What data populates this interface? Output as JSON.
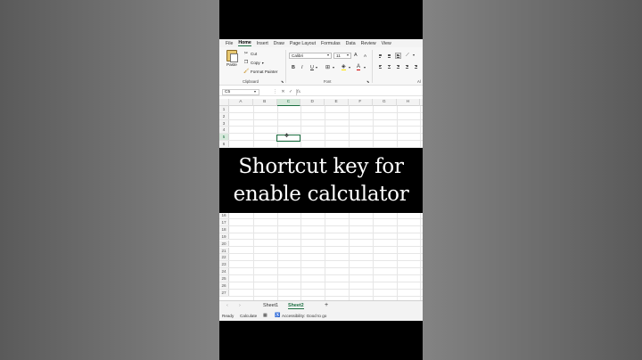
{
  "ribbon": {
    "tabs": [
      "File",
      "Home",
      "Insert",
      "Draw",
      "Page Layout",
      "Formulas",
      "Data",
      "Review",
      "View"
    ],
    "active_tab": "Home",
    "clipboard": {
      "paste": "Paste",
      "cut": "Cut",
      "copy": "Copy",
      "format_painter": "Format Painter",
      "label": "Clipboard"
    },
    "font": {
      "name": "Calibri",
      "size": "11",
      "label": "Font",
      "bold": "B",
      "italic": "I",
      "underline": "U",
      "grow": "A",
      "shrink": "A"
    },
    "alignment_label": "Al"
  },
  "formula_bar": {
    "name_box": "C5",
    "fx": "fx",
    "value": ""
  },
  "grid": {
    "columns": [
      "A",
      "B",
      "C",
      "D",
      "E",
      "F",
      "G",
      "H"
    ],
    "selected_column": "C",
    "top_rows": [
      "1",
      "2",
      "3",
      "4",
      "5",
      "6"
    ],
    "selected_row": "5",
    "bottom_rows": [
      "16",
      "17",
      "18",
      "19",
      "20",
      "21",
      "22",
      "23",
      "24",
      "25",
      "26",
      "27"
    ]
  },
  "sheets": {
    "tabs": [
      "Sheet1",
      "Sheet2"
    ],
    "active": "Sheet2",
    "add": "+"
  },
  "status": {
    "ready": "Ready",
    "calculate": "Calculate",
    "accessibility": "Accessibility: Good to go"
  },
  "caption": {
    "line1": "Shortcut key for",
    "line2": "enable calculator"
  },
  "colors": {
    "excel_green": "#1d6f42",
    "highlight_yellow": "#ffe600",
    "font_red": "#d00000"
  }
}
